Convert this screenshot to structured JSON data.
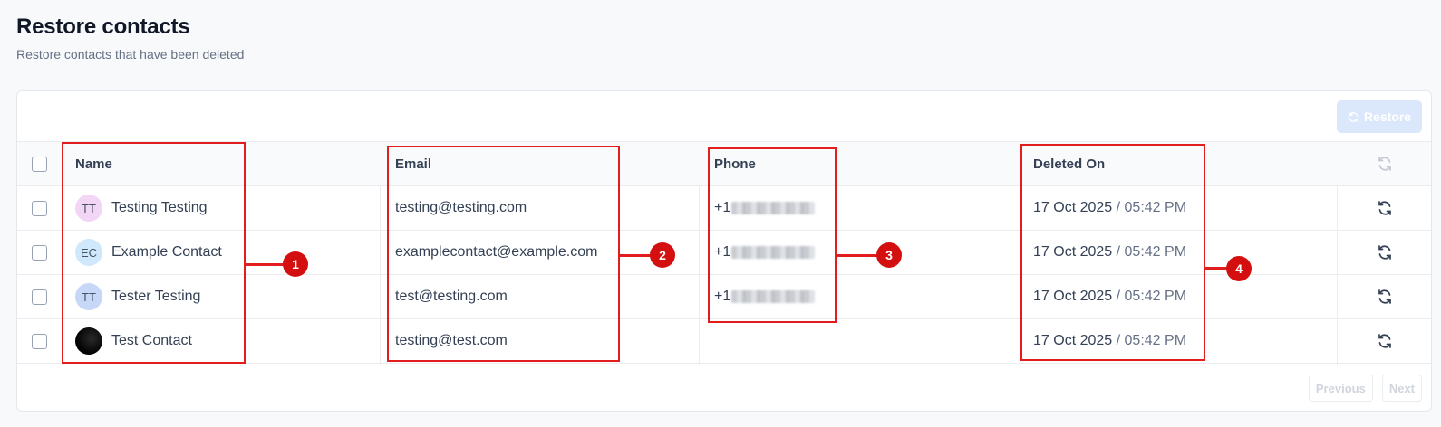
{
  "header": {
    "title": "Restore contacts",
    "subtitle": "Restore contacts that have been deleted"
  },
  "toolbar": {
    "restore_label": "Restore"
  },
  "table": {
    "columns": {
      "name": "Name",
      "email": "Email",
      "phone": "Phone",
      "deleted_on": "Deleted On"
    },
    "rows": [
      {
        "initials": "TT",
        "avatar_color": "#f3d6f5",
        "name": "Testing Testing",
        "email": "testing@testing.com",
        "phone_prefix": "+1",
        "phone_redacted": true,
        "date": "17 Oct 2025",
        "separator": "/",
        "time": "05:42 PM"
      },
      {
        "initials": "EC",
        "avatar_color": "#cfe8fb",
        "name": "Example Contact",
        "email": "examplecontact@example.com",
        "phone_prefix": "+1",
        "phone_redacted": true,
        "date": "17 Oct 2025",
        "separator": "/",
        "time": "05:42 PM"
      },
      {
        "initials": "TT",
        "avatar_color": "#c7d7f7",
        "name": "Tester Testing",
        "email": "test@testing.com",
        "phone_prefix": "+1",
        "phone_redacted": true,
        "date": "17 Oct 2025",
        "separator": "/",
        "time": "05:42 PM"
      },
      {
        "initials": "",
        "avatar_color": "#000000",
        "name": "Test Contact",
        "email": "testing@test.com",
        "phone_prefix": "",
        "phone_redacted": false,
        "date": "17 Oct 2025",
        "separator": "/",
        "time": "05:42 PM"
      }
    ]
  },
  "pagination": {
    "previous": "Previous",
    "next": "Next"
  },
  "annotations": [
    "1",
    "2",
    "3",
    "4"
  ],
  "colors": {
    "annotation": "#e11d1d",
    "restore_disabled": "#dbe7fb"
  },
  "icons": {
    "restore": "refresh-icon"
  }
}
